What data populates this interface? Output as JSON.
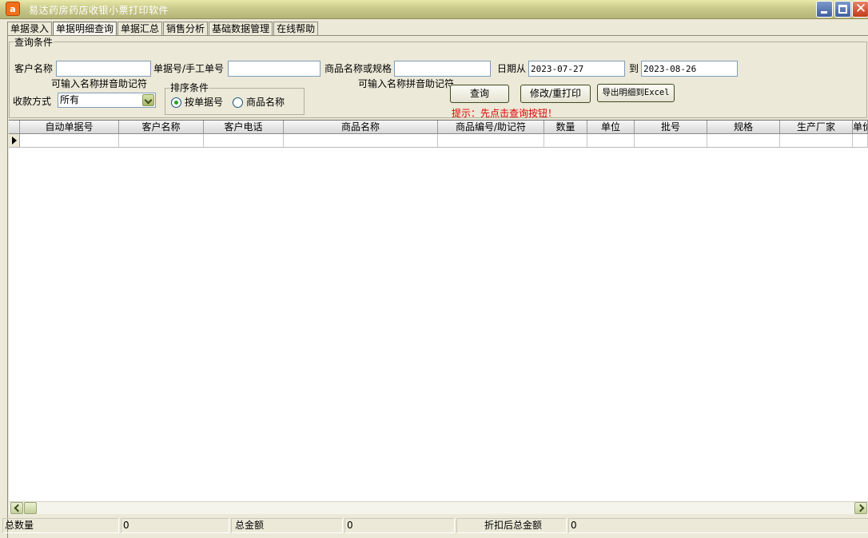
{
  "window": {
    "title": "易达药房药店收银小票打印软件",
    "icon_letter": "a"
  },
  "tabs": [
    {
      "label": "单据录入",
      "active": false
    },
    {
      "label": "单据明细查询",
      "active": true
    },
    {
      "label": "单据汇总",
      "active": false
    },
    {
      "label": "销售分析",
      "active": false
    },
    {
      "label": "基础数据管理",
      "active": false
    },
    {
      "label": "在线帮助",
      "active": false
    }
  ],
  "query": {
    "group_title": "查询条件",
    "customer_label": "客户名称",
    "customer_value": "",
    "customer_hint": "可输入名称拼音助记符",
    "bill_label": "单据号/手工单号",
    "bill_value": "",
    "product_label": "商品名称或规格",
    "product_value": "",
    "product_hint": "可输入名称拼音助记符",
    "date_from_label": "日期从",
    "date_from": "2023-07-27",
    "date_to_label": "到",
    "date_to": "2023-08-26",
    "payment_label": "收款方式",
    "payment_value": "所有",
    "sort_title": "排序条件",
    "sort_options": [
      {
        "label": "按单据号",
        "selected": true
      },
      {
        "label": "商品名称",
        "selected": false
      }
    ],
    "buttons": {
      "query": "查询",
      "modify_print": "修改/重打印",
      "export": "导出明细到Excel"
    },
    "tip": "提示：先点击查询按钮！"
  },
  "grid": {
    "columns": [
      "自动单据号",
      "客户名称",
      "客户电话",
      "商品名称",
      "商品编号/助记符",
      "数量",
      "单位",
      "批号",
      "规格",
      "生产厂家",
      "单价"
    ],
    "rows": []
  },
  "footer": {
    "total_qty_label": "总数量",
    "total_qty": "0",
    "total_amount_label": "总金额",
    "total_amount": "0",
    "discount_total_label": "折扣后总金额",
    "discount_total": "0"
  },
  "colors": {
    "accent_title": "#c9c98a",
    "tip_red": "#e00000"
  }
}
